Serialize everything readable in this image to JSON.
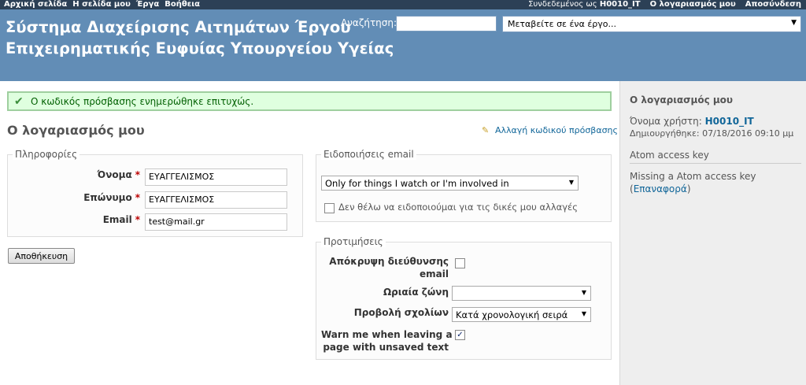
{
  "top_menu": {
    "items": [
      "Αρχική σελίδα",
      "Η σελίδα μου",
      "Έργα",
      "Βοήθεια"
    ],
    "logged_as_label": "Συνδεδεμένος ως",
    "logged_user": "H0010_IT",
    "my_account": "Ο λογαριασμός μου",
    "logout": "Αποσύνδεση"
  },
  "header": {
    "title_line1": "Σύστημα Διαχείρισης Αιτημάτων Έργου",
    "title_line2": "Επιχειρηματικής Ευφυίας Υπουργείου Υγείας",
    "search_label": "Αναζήτηση:",
    "search_value": "",
    "project_jump": "Μεταβείτε σε ένα έργο..."
  },
  "flash": {
    "message": "Ο κωδικός πρόσβασης ενημερώθηκε επιτυχώς."
  },
  "page": {
    "title": "Ο λογαριασμός μου",
    "change_password": "Αλλαγή κωδικού πρόσβασης"
  },
  "info": {
    "legend": "Πληροφορίες",
    "firstname_label": "Όνομα",
    "firstname_value": "ΕΥΑΓΓΕΛΙΣΜΟΣ",
    "lastname_label": "Επώνυμο",
    "lastname_value": "ΕΥΑΓΓΕΛΙΣΜΟΣ",
    "email_label": "Email",
    "email_value": "test@mail.gr",
    "required_mark": "*"
  },
  "email_notifications": {
    "legend": "Ειδοποιήσεις email",
    "selected": "Only for things I watch or I'm involved in",
    "no_self_notified_label": "Δεν θέλω να ειδοποιούμαι για τις δικές μου αλλαγές",
    "no_self_notified_checked": false
  },
  "preferences": {
    "legend": "Προτιμήσεις",
    "hide_mail_label_1": "Απόκρυψη διεύθυνσης",
    "hide_mail_label_2": "email",
    "hide_mail_checked": false,
    "timezone_label": "Ωριαία ζώνη",
    "timezone_value": "",
    "comments_order_label": "Προβολή σχολίων",
    "comments_order_value": "Κατά χρονολογική σειρά",
    "warn_leaving_label_1": "Warn me when leaving a",
    "warn_leaving_label_2": "page with unsaved text",
    "warn_leaving_checked": true
  },
  "save_button": "Αποθήκευση",
  "sidebar": {
    "title": "Ο λογαριασμός μου",
    "login_label": "Όνομα χρήστη:",
    "login_value": "H0010_IT",
    "created_label": "Δημιουργήθηκε:",
    "created_value": "07/18/2016 09:10 μμ",
    "atom_title": "Atom access key",
    "atom_missing": "Missing a Atom access key",
    "atom_reset": "Επαναφορά"
  },
  "icons": {
    "success": "check-icon",
    "change_password": "pencil-icon",
    "dropdown": "chevron-down-icon"
  },
  "colors": {
    "top_menu_bg": "#2c4056",
    "header_bg": "#628db6",
    "flash_bg": "#dfffdf",
    "flash_border": "#9fcf9f",
    "link": "#116699",
    "required": "#bb0000",
    "sidebar_bg": "#eeeeee"
  }
}
